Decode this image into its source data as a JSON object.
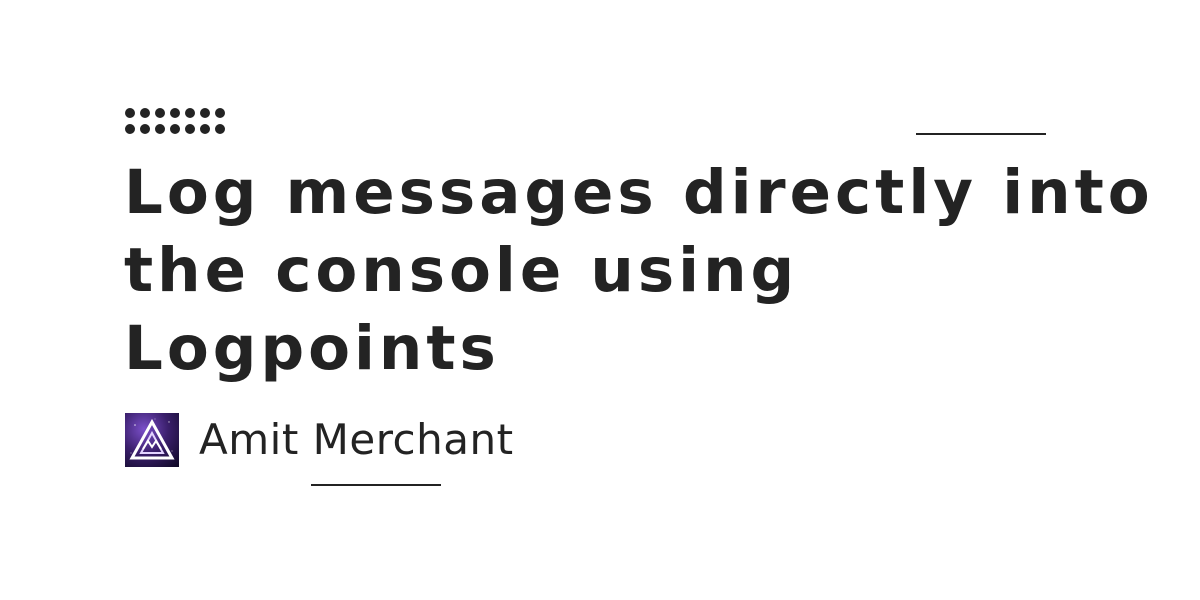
{
  "post": {
    "title": "Log messages directly into the console using Logpoints",
    "author": "Amit Merchant"
  },
  "icons": {
    "avatar": "mountain-triangle-logo-icon",
    "decoration": "dot-grid-icon"
  },
  "colors": {
    "text": "#232323",
    "background": "#ffffff",
    "avatar_bg": "#3a1f6b",
    "avatar_glow": "#b98cff"
  }
}
